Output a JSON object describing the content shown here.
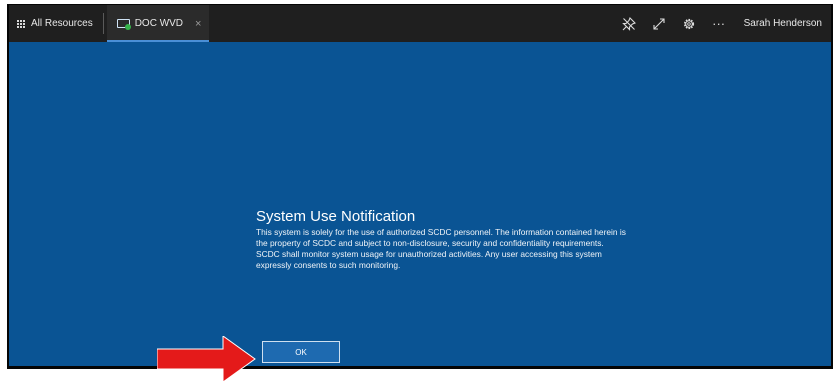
{
  "titlebar": {
    "all_resources_label": "All Resources",
    "active_tab_label": "DOC WVD",
    "close_glyph": "×",
    "more_glyph": "···",
    "user_name": "Sarah Henderson",
    "icons": [
      "grid-icon",
      "monitor-icon",
      "pin-icon",
      "expand-icon",
      "gear-icon",
      "more-icon"
    ]
  },
  "dialog": {
    "title": "System Use Notification",
    "body": "This system is solely for the use of authorized SCDC personnel.  The information contained herein is the property of SCDC and subject to non-disclosure, security and confidentiality requirements.  SCDC shall monitor system usage for unauthorized activities.  Any user accessing this system expressly consents to such monitoring.",
    "ok_label": "OK"
  },
  "colors": {
    "desktop_background": "#0a5494",
    "titlebar_background": "#1f1f1f",
    "active_tab_accent": "#4a8fd6",
    "annotation_arrow": "#e41a1a"
  }
}
